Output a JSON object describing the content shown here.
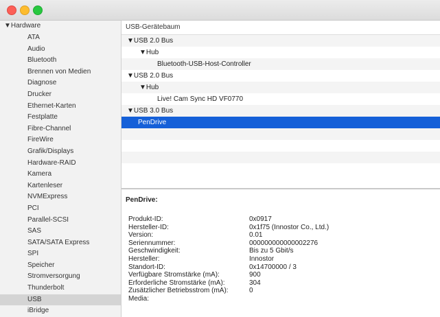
{
  "sidebar": {
    "header": "▼Hardware",
    "items": [
      "ATA",
      "Audio",
      "Bluetooth",
      "Brennen von Medien",
      "Diagnose",
      "Drucker",
      "Ethernet-Karten",
      "Festplatte",
      "Fibre-Channel",
      "FireWire",
      "Grafik/Displays",
      "Hardware-RAID",
      "Kamera",
      "Kartenleser",
      "NVMExpress",
      "PCI",
      "Parallel-SCSI",
      "SAS",
      "SATA/SATA Express",
      "SPI",
      "Speicher",
      "Stromversorgung",
      "Thunderbolt",
      "USB",
      "iBridge"
    ],
    "selected": "USB"
  },
  "tree": {
    "header": "USB-Gerätebaum",
    "rows": [
      {
        "label": "▼USB 2.0 Bus"
      },
      {
        "label": "▼Hub"
      },
      {
        "label": "Bluetooth-USB-Host-Controller"
      },
      {
        "label": "▼USB 2.0 Bus"
      },
      {
        "label": "▼Hub"
      },
      {
        "label": "Live! Cam Sync HD VF0770"
      },
      {
        "label": "▼USB 3.0 Bus"
      },
      {
        "label": "PenDrive"
      }
    ]
  },
  "detail": {
    "title": "PenDrive:",
    "props": [
      {
        "key": "Produkt-ID:",
        "value": "0x0917"
      },
      {
        "key": "Hersteller-ID:",
        "value": "0x1f75  (Innostor Co., Ltd.)"
      },
      {
        "key": "Version:",
        "value": "0.01"
      },
      {
        "key": "Seriennummer:",
        "value": "000000000000002276"
      },
      {
        "key": "Geschwindigkeit:",
        "value": "Bis zu 5 Gbit/s"
      },
      {
        "key": "Hersteller:",
        "value": "Innostor"
      },
      {
        "key": "Standort-ID:",
        "value": "0x14700000 / 3"
      },
      {
        "key": "Verfügbare Stromstärke (mA):",
        "value": "900"
      },
      {
        "key": "Erforderliche Stromstärke (mA):",
        "value": "304"
      },
      {
        "key": "Zusätzlicher Betriebsstrom (mA):",
        "value": "0"
      },
      {
        "key": "Media:",
        "value": ""
      }
    ]
  },
  "colors": {
    "selection": "#1560d8",
    "sidebar_selection": "#d4d4d4",
    "close": "#fc5f57",
    "minimize": "#fdbc2e",
    "maximize": "#28c840"
  }
}
